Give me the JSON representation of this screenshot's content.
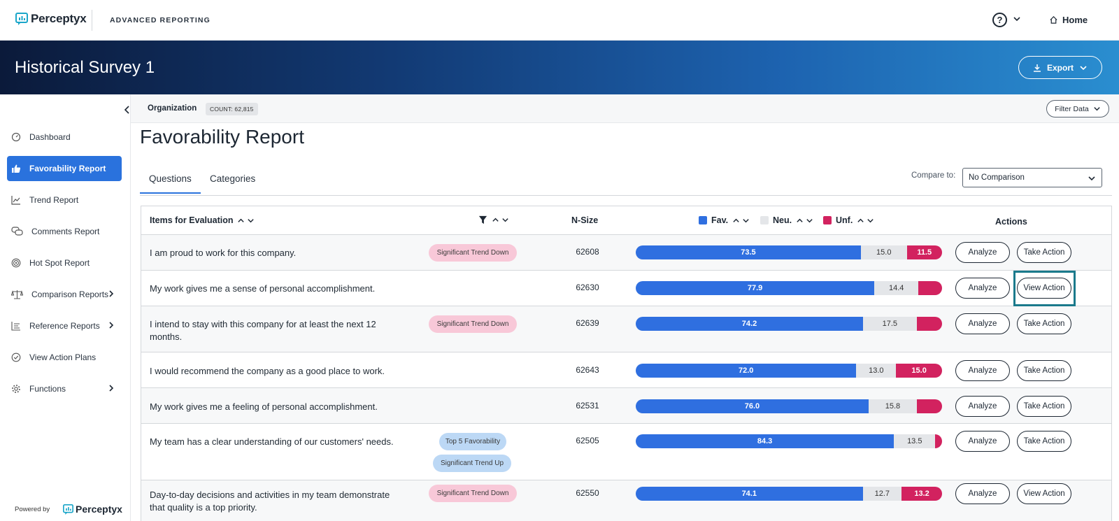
{
  "topnav": {
    "logo": "Perceptyx",
    "app_label": "ADVANCED REPORTING",
    "help": "?",
    "home": "Home"
  },
  "banner": {
    "title": "Historical Survey 1",
    "export": "Export"
  },
  "sidebar": {
    "items": [
      {
        "label": "Dashboard",
        "icon": "gauge-icon"
      },
      {
        "label": "Favorability Report",
        "icon": "thumbs-up-icon"
      },
      {
        "label": "Trend Report",
        "icon": "trend-icon"
      },
      {
        "label": "Comments Report",
        "icon": "comments-icon"
      },
      {
        "label": "Hot Spot Report",
        "icon": "target-icon"
      },
      {
        "label": "Comparison Reports",
        "icon": "scale-icon"
      },
      {
        "label": "Reference Reports",
        "icon": "list-icon"
      },
      {
        "label": "View Action Plans",
        "icon": "check-circle-icon"
      },
      {
        "label": "Functions",
        "icon": "gear-icon"
      }
    ],
    "powered_by": "Powered by",
    "powered_logo": "Perceptyx"
  },
  "orgbar": {
    "label": "Organization",
    "count": "COUNT: 62,815",
    "filter": "Filter Data"
  },
  "page_title": "Favorability Report",
  "tabs": [
    {
      "label": "Questions"
    },
    {
      "label": "Categories"
    }
  ],
  "compare": {
    "label": "Compare to:",
    "value": "No Comparison"
  },
  "table": {
    "headers": {
      "items": "Items for Evaluation",
      "nsize": "N-Size",
      "fav": "Fav.",
      "neu": "Neu.",
      "unf": "Unf.",
      "actions": "Actions"
    },
    "colors": {
      "fav": "#2f6fe0",
      "neu": "#e4e6e9",
      "unf": "#d2225f"
    },
    "rows": [
      {
        "question": "I am proud to work for this company.",
        "tags": [
          "Significant Trend Down"
        ],
        "nsize": "62608",
        "fav": "73.5",
        "neu": "15.0",
        "unf": "11.5",
        "action": "Take Action"
      },
      {
        "question": "My work gives me a sense of personal accomplishment.",
        "tags": [],
        "nsize": "62630",
        "fav": "77.9",
        "neu": "14.4",
        "unf": "",
        "action": "View Action"
      },
      {
        "question": "I intend to stay with this company for at least the next 12 months.",
        "tags": [
          "Significant Trend Down"
        ],
        "nsize": "62639",
        "fav": "74.2",
        "neu": "17.5",
        "unf": "",
        "action": "Take Action"
      },
      {
        "question": "I would recommend the company as a good place to work.",
        "tags": [],
        "nsize": "62643",
        "fav": "72.0",
        "neu": "13.0",
        "unf": "15.0",
        "action": "Take Action"
      },
      {
        "question": "My work gives me a feeling of personal accomplishment.",
        "tags": [],
        "nsize": "62531",
        "fav": "76.0",
        "neu": "15.8",
        "unf": "",
        "action": "Take Action"
      },
      {
        "question": "My team has a clear understanding of our customers' needs.",
        "tags": [
          "Top 5 Favorability",
          "Significant Trend Up"
        ],
        "nsize": "62505",
        "fav": "84.3",
        "neu": "13.5",
        "unf": "",
        "action": "Take Action"
      },
      {
        "question": "Day-to-day decisions and activities in my team demonstrate that quality is a top priority.",
        "tags": [
          "Significant Trend Down"
        ],
        "nsize": "62550",
        "fav": "74.1",
        "neu": "12.7",
        "unf": "13.2",
        "action": "View Action"
      }
    ],
    "analyze_label": "Analyze"
  }
}
